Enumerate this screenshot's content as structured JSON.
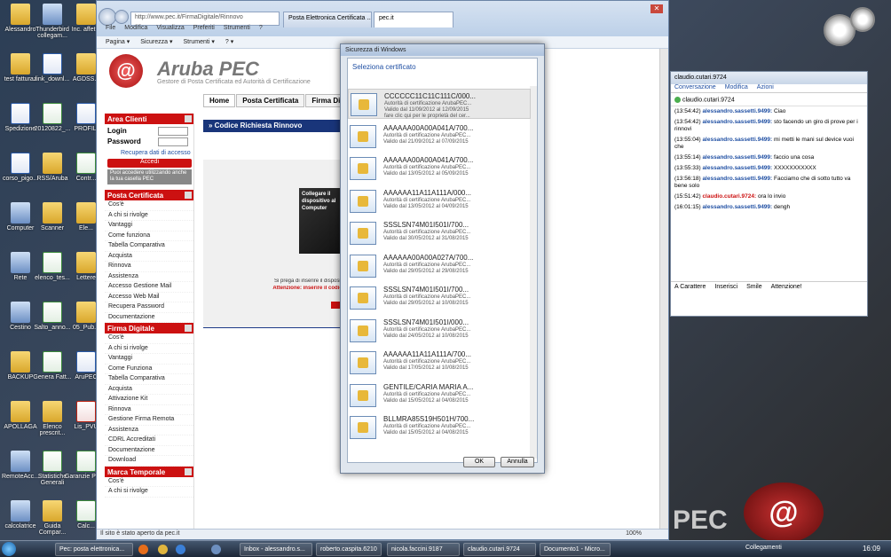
{
  "desktop": {
    "icons": [
      {
        "label": "Alessandro",
        "type": "folder"
      },
      {
        "label": "Thunderbird collegam...",
        "type": "sys"
      },
      {
        "label": "Inc. affet...",
        "type": "folder"
      },
      {
        "label": "test fatturaz",
        "type": "folder"
      },
      {
        "label": "link_downl...",
        "type": "doc"
      },
      {
        "label": "AGDSS...",
        "type": "folder"
      },
      {
        "label": "Spedizione",
        "type": "doc"
      },
      {
        "label": "20120822_...",
        "type": "xls"
      },
      {
        "label": "PROFILI",
        "type": "doc"
      },
      {
        "label": "corso_pigo...",
        "type": "doc"
      },
      {
        "label": "RSS/Aruba",
        "type": "folder"
      },
      {
        "label": "Contr...",
        "type": "xls"
      },
      {
        "label": "Computer",
        "type": "sys"
      },
      {
        "label": "Scanner",
        "type": "folder"
      },
      {
        "label": "Ele...",
        "type": "folder"
      },
      {
        "label": "Rete",
        "type": "sys"
      },
      {
        "label": "elenco_tes...",
        "type": "xls"
      },
      {
        "label": "Lettere",
        "type": "folder"
      },
      {
        "label": "Cestino",
        "type": "sys"
      },
      {
        "label": "Salto_anno...",
        "type": "xls"
      },
      {
        "label": "05_Pub...",
        "type": "folder"
      },
      {
        "label": "BACKUP",
        "type": "folder"
      },
      {
        "label": "Genera Fatt...",
        "type": "xls"
      },
      {
        "label": "AruPEC",
        "type": "doc"
      },
      {
        "label": "APOLLAGA",
        "type": "folder"
      },
      {
        "label": "Elenco prescrit...",
        "type": "folder"
      },
      {
        "label": "Lis_PVU",
        "type": "pdf"
      },
      {
        "label": "RemoteAcc...",
        "type": "sys"
      },
      {
        "label": "Statistiche Generali",
        "type": "xls"
      },
      {
        "label": "Garanzie Pec...",
        "type": "xls"
      },
      {
        "label": "calcolatrice",
        "type": "sys"
      },
      {
        "label": "Guida Compar...",
        "type": "folder"
      },
      {
        "label": "Calc...",
        "type": "xls"
      }
    ]
  },
  "browser": {
    "address": "http://www.pec.it/FirmaDigitale/Rinnovo",
    "tabs": [
      "Posta Elettronica Certificata ...",
      "pec.it"
    ],
    "menu": [
      "File",
      "Modifica",
      "Visualizza",
      "Preferiti",
      "Strumenti",
      "?"
    ],
    "commands": [
      "Pagina ▾",
      "Sicurezza ▾",
      "Strumenti ▾",
      "? ▾"
    ],
    "status": "Il sito è stato aperto da pec.it",
    "zoom": "100%"
  },
  "aruba": {
    "logo_glyph": "@",
    "brand": "Aruba PEC",
    "tagline": "Gestore di Posta Certificata ed Autorità di Certificazione",
    "topnav": [
      "Home",
      "Posta Certificata",
      "Firma Digitale"
    ],
    "area_clienti": {
      "title": "Area Clienti",
      "login_label": "Login",
      "password_label": "Password",
      "recover": "Recupera dati di accesso",
      "button": "Accedi",
      "note": "Puoi accedere utilizzando anche la tua casella PEC"
    },
    "posta_certificata": {
      "title": "Posta Certificata",
      "items": [
        "Cos'è",
        "A chi si rivolge",
        "Vantaggi",
        "Come funziona",
        "Tabella Comparativa",
        "Acquista",
        "Rinnova",
        "Assistenza",
        "Accesso Gestione Mail",
        "Accesso Web Mail",
        "Recupera Password",
        "Documentazione"
      ]
    },
    "firma_digitale": {
      "title": "Firma Digitale",
      "items": [
        "Cos'è",
        "A chi si rivolge",
        "Vantaggi",
        "Come Funziona",
        "Tabella Comparativa",
        "Acquista",
        "Attivazione Kit",
        "Rinnova",
        "Gestione Firma Remota",
        "Assistenza",
        "CDRL Accreditati",
        "Documentazione",
        "Download"
      ]
    },
    "marca_temporale": {
      "title": "Marca Temporale",
      "items": [
        "Cos'è",
        "A chi si rivolge"
      ]
    },
    "main_title": "Codice Richiesta Rinnovo",
    "promo": "Collegare il dispositivo al Computer",
    "instruction": "Si prega di inserire il dispositivo",
    "warning": "Attenzione: inserire il codice"
  },
  "dialog": {
    "title": "Sicurezza di Windows",
    "heading": "Seleziona certificato",
    "certificates": [
      {
        "name": "CCCCCC11C11C111C/000...",
        "issuer": "Autorità di certificazione ArubaPEC...",
        "validity": "Valido dal 11/09/2012 al 12/09/2015",
        "extra": "fare clic qui per le proprietà del cer...",
        "selected": true
      },
      {
        "name": "AAAAAA00A00A041A/700...",
        "issuer": "Autorità di certificazione ArubaPEC...",
        "validity": "Valido dal 21/09/2012 al 07/09/2015"
      },
      {
        "name": "AAAAAA00A00A041A/700...",
        "issuer": "Autorità di certificazione ArubaPEC...",
        "validity": "Valido dal 13/05/2012 al 05/09/2015"
      },
      {
        "name": "AAAAAA11A11A111A/000...",
        "issuer": "Autorità di certificazione ArubaPEC...",
        "validity": "Valido dal 13/05/2012 al 04/09/2015"
      },
      {
        "name": "SSSLSN74M01I501I/700...",
        "issuer": "Autorità di certificazione ArubaPEC...",
        "validity": "Valido dal 30/05/2012 al 31/08/2015"
      },
      {
        "name": "AAAAAA00A00A027A/700...",
        "issuer": "Autorità di certificazione ArubaPEC...",
        "validity": "Valido dal 29/05/2012 al 29/08/2015"
      },
      {
        "name": "SSSLSN74M01I501I/700...",
        "issuer": "Autorità di certificazione ArubaPEC...",
        "validity": "Valido dal 29/05/2012 al 10/08/2015"
      },
      {
        "name": "SSSLSN74M01I501I/000...",
        "issuer": "Autorità di certificazione ArubaPEC...",
        "validity": "Valido dal 24/05/2012 al 10/08/2015"
      },
      {
        "name": "AAAAAA11A11A111A/700...",
        "issuer": "Autorità di certificazione ArubaPEC...",
        "validity": "Valido dal 17/05/2012 al 10/08/2015"
      },
      {
        "name": "GENTILE/CARIA MARIA A...",
        "issuer": "Autorità di certificazione ArubaPEC...",
        "validity": "Valido dal 15/05/2012 al 04/08/2015"
      },
      {
        "name": "BLLMRA85S19H501H/700...",
        "issuer": "Autorità di certificazione ArubaPEC...",
        "validity": "Valido dal 15/05/2012 al 04/08/2015"
      }
    ],
    "ok": "OK",
    "cancel": "Annulla"
  },
  "chat": {
    "title": "claudio.cutari.9724",
    "tabs": [
      "Conversazione",
      "Modifica",
      "Azioni"
    ],
    "contact": "claudio.cutari.9724",
    "messages": [
      {
        "time": "(13:54:42)",
        "who": "alessandro.sassetti.9499:",
        "text": "Ciao",
        "self": false
      },
      {
        "time": "(13:54:42)",
        "who": "alessandro.sassetti.9499:",
        "text": "sto facendo un giro di prove per i rinnovi",
        "self": false
      },
      {
        "time": "(13:55:04)",
        "who": "alessandro.sassetti.9499:",
        "text": "mi metti le mani sul device vuoi che",
        "self": false
      },
      {
        "time": "(13:55:14)",
        "who": "alessandro.sassetti.9499:",
        "text": "faccio una cosa",
        "self": false
      },
      {
        "time": "(13:55:33)",
        "who": "alessandro.sassetti.9499:",
        "text": "XXXXXXXXXXX",
        "self": false
      },
      {
        "time": "(13:56:18)",
        "who": "alessandro.sassetti.9499:",
        "text": "Facciamo che di sotto tutto va bene solo",
        "self": false
      },
      {
        "time": "(15:51:42)",
        "who": "claudio.cutari.9724:",
        "text": "ora lo invio",
        "self": true
      },
      {
        "time": "(16:01:15)",
        "who": "alessandro.sassetti.9499:",
        "text": "dengh",
        "self": false
      }
    ],
    "toolbar": [
      "A Carattere",
      "Inserisci",
      "Smile",
      "Attenzione!"
    ]
  },
  "taskbar": {
    "items": [
      "Pec: posta elettronica...",
      "Inbox - alessandro.s...",
      "roberto.caspita.6210",
      "nicola.faccini.9187",
      "claudio.cutari.9724",
      "Documento1 - Micro..."
    ],
    "tray_label": "Collegamenti",
    "clock": "16:09"
  },
  "wallpaper_text": "PEC"
}
